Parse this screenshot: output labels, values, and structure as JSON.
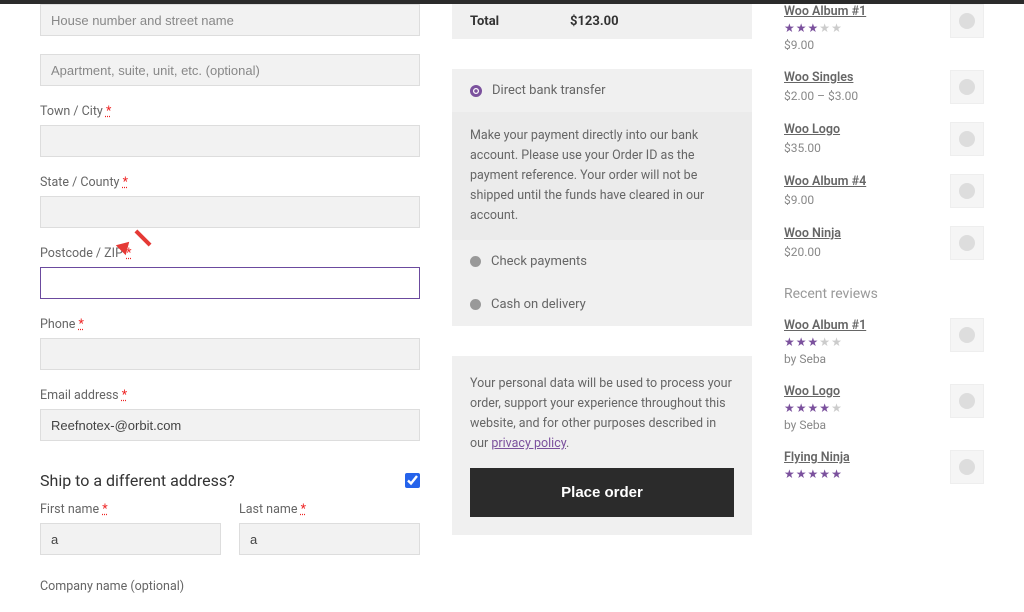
{
  "billing": {
    "house_ph": "House number and street name",
    "apt_ph": "Apartment, suite, unit, etc. (optional)",
    "town_label": "Town / City",
    "state_label": "State / County",
    "postcode_label": "Postcode / ZIP",
    "phone_label": "Phone",
    "email_label": "Email address",
    "email_val": "Reefnotex-@orbit.com"
  },
  "shipping": {
    "heading": "Ship to a different address?",
    "first_label": "First name",
    "first_val": "a",
    "last_label": "Last name",
    "last_val": "a",
    "company_label": "Company name (optional)"
  },
  "order": {
    "total_label": "Total",
    "total_val": "$123.00",
    "payments": {
      "bank": "Direct bank transfer",
      "bank_desc": "Make your payment directly into our bank account. Please use your Order ID as the payment reference. Your order will not be shipped until the funds have cleared in our account.",
      "check": "Check payments",
      "cod": "Cash on delivery"
    },
    "privacy": "Your personal data will be used to process your order, support your experience throughout this website, and for other purposes described in our ",
    "privacy_link": "privacy policy",
    "place_btn": "Place order"
  },
  "sidebar": {
    "products": [
      {
        "name": "Woo Album #1",
        "price": "$9.00",
        "stars": 3
      },
      {
        "name": "Woo Singles",
        "price": "$2.00 – $3.00",
        "stars": 0
      },
      {
        "name": "Woo Logo",
        "price": "$35.00",
        "stars": 0
      },
      {
        "name": "Woo Album #4",
        "price": "$9.00",
        "stars": 0
      },
      {
        "name": "Woo Ninja",
        "price": "$20.00",
        "stars": 0
      }
    ],
    "reviews_head": "Recent reviews",
    "reviews": [
      {
        "name": "Woo Album #1",
        "stars": 3,
        "by": "by Seba"
      },
      {
        "name": "Woo Logo",
        "stars": 4,
        "by": "by Seba"
      },
      {
        "name": "Flying Ninja",
        "stars": 5,
        "by": ""
      }
    ]
  }
}
